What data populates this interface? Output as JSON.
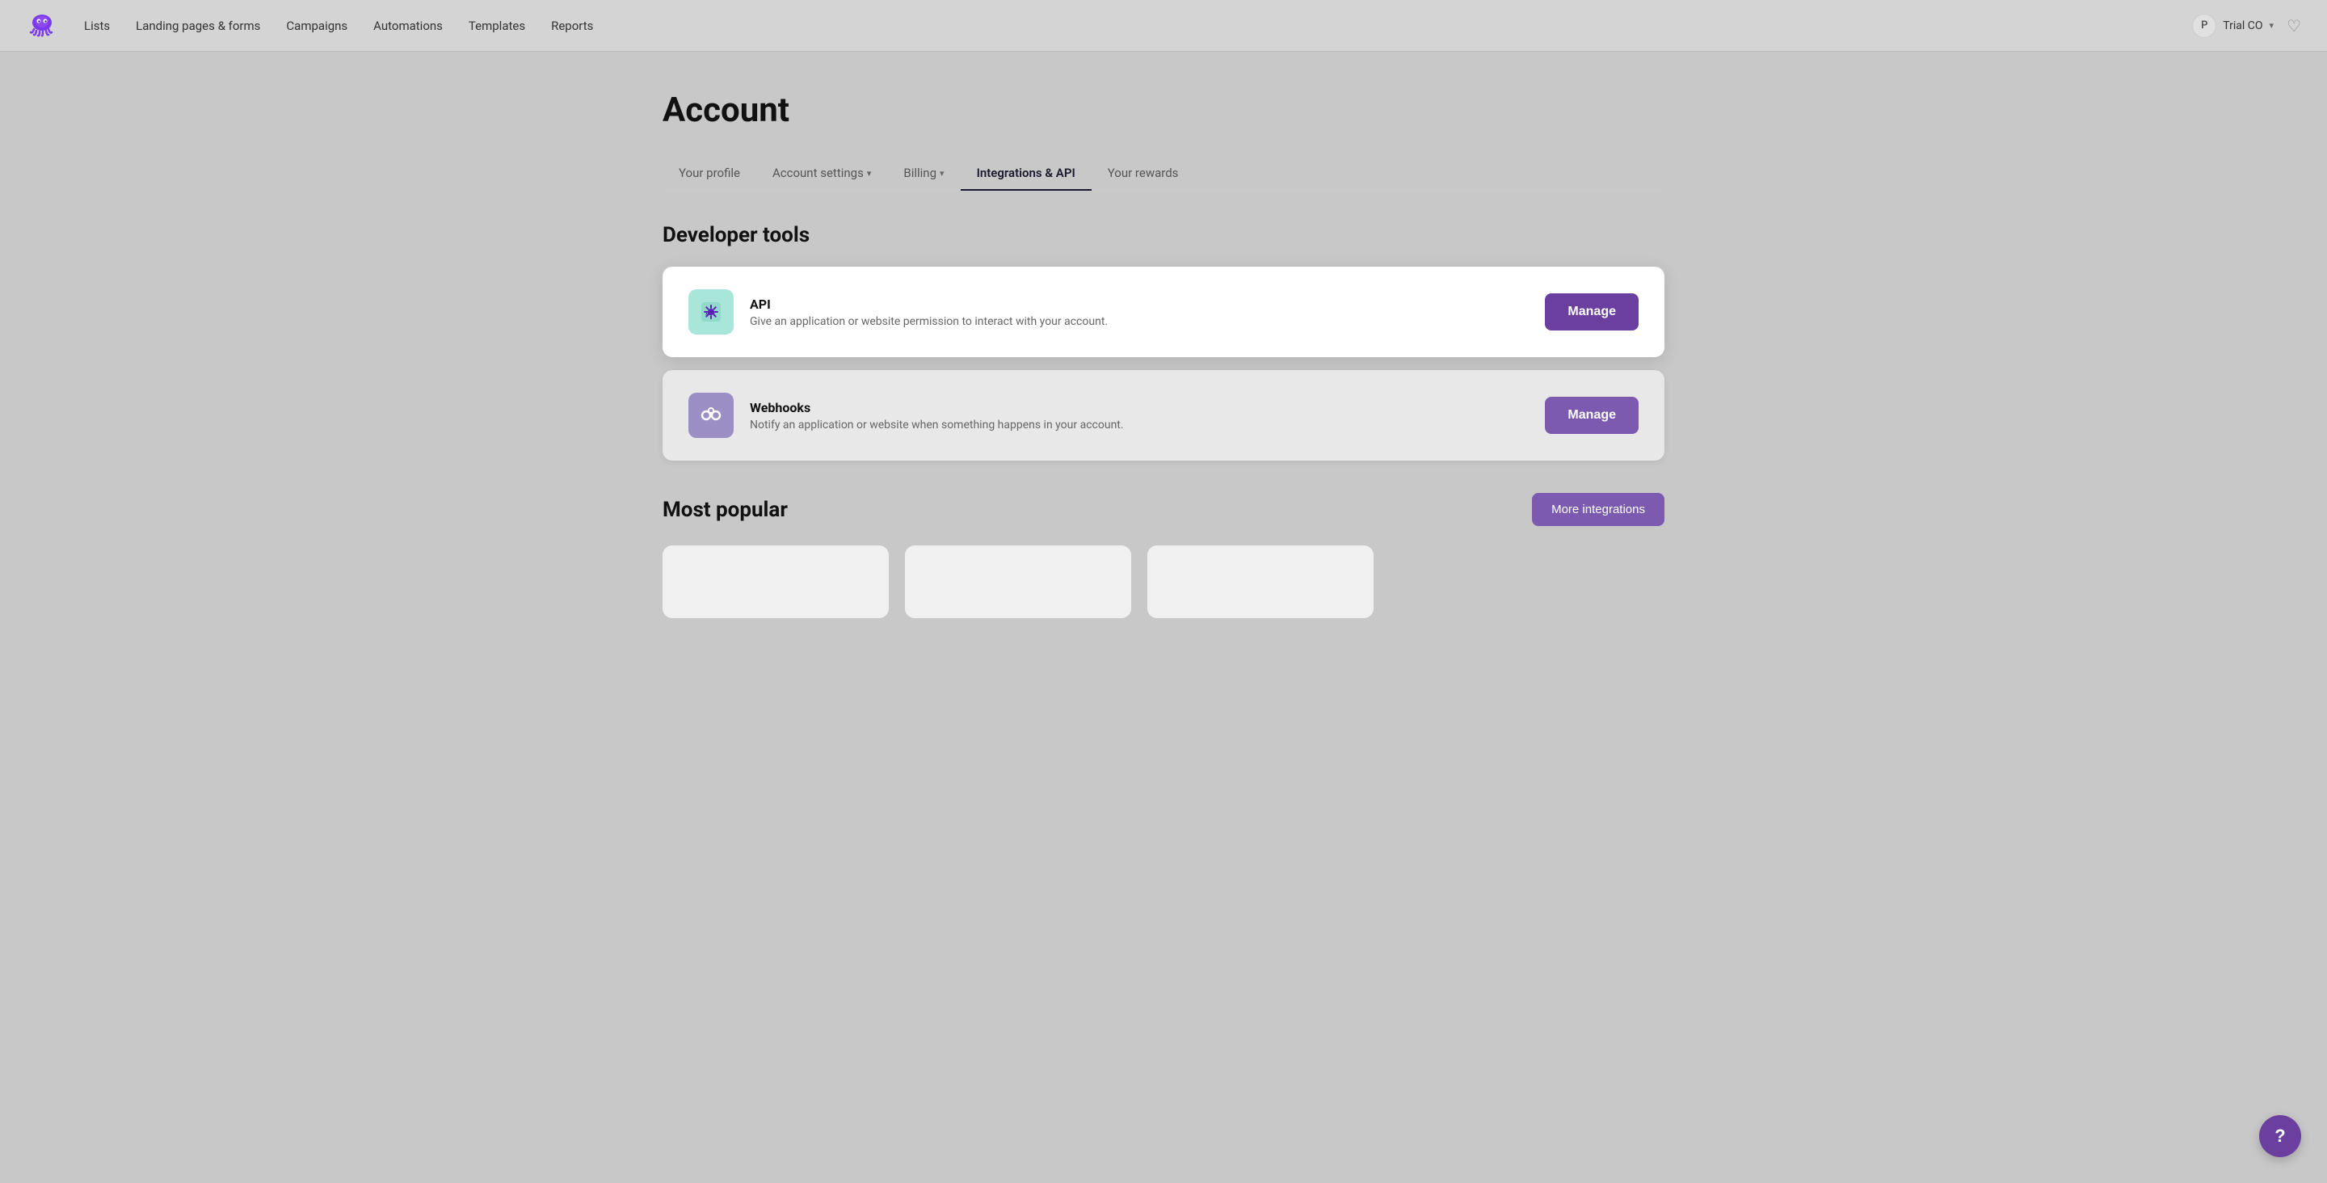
{
  "navbar": {
    "logo_alt": "Octopus logo",
    "nav_items": [
      {
        "label": "Lists",
        "id": "lists"
      },
      {
        "label": "Landing pages & forms",
        "id": "landing-pages"
      },
      {
        "label": "Campaigns",
        "id": "campaigns"
      },
      {
        "label": "Automations",
        "id": "automations"
      },
      {
        "label": "Templates",
        "id": "templates"
      },
      {
        "label": "Reports",
        "id": "reports"
      }
    ],
    "account_initial": "P",
    "account_name": "Trial CO",
    "heart_icon": "♡",
    "chevron": "▾"
  },
  "page": {
    "title": "Account"
  },
  "tabs": [
    {
      "label": "Your profile",
      "id": "your-profile",
      "active": false,
      "has_dropdown": false
    },
    {
      "label": "Account settings",
      "id": "account-settings",
      "active": false,
      "has_dropdown": true
    },
    {
      "label": "Billing",
      "id": "billing",
      "active": false,
      "has_dropdown": true
    },
    {
      "label": "Integrations & API",
      "id": "integrations-api",
      "active": true,
      "has_dropdown": false
    },
    {
      "label": "Your rewards",
      "id": "your-rewards",
      "active": false,
      "has_dropdown": false
    }
  ],
  "developer_tools": {
    "section_title": "Developer tools",
    "tools": [
      {
        "id": "api",
        "name": "API",
        "description": "Give an application or website permission to interact with your account.",
        "icon_type": "api",
        "button_label": "Manage",
        "elevated": true
      },
      {
        "id": "webhooks",
        "name": "Webhooks",
        "description": "Notify an application or website when something happens in your account.",
        "icon_type": "webhook",
        "button_label": "Manage",
        "elevated": false
      }
    ]
  },
  "most_popular": {
    "section_title": "Most popular",
    "more_button_label": "More integrations"
  },
  "help": {
    "button_label": "?"
  }
}
